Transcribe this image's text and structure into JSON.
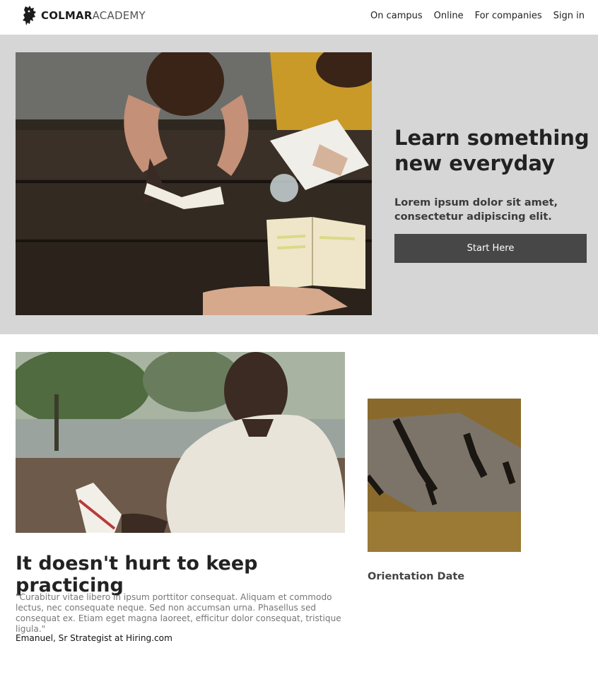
{
  "header": {
    "logo": {
      "bold": "COLMAR",
      "light": "ACADEMY"
    },
    "nav": [
      "On campus",
      "Online",
      "For companies",
      "Sign in"
    ]
  },
  "hero": {
    "title": "Learn something new everyday",
    "subtitle": "Lorem ipsum dolor sit amet, consectetur adipiscing elit.",
    "button_label": "Start Here"
  },
  "practice": {
    "title": "It doesn't hurt to keep practicing",
    "quote": "\"Curabitur vitae libero in ipsum porttitor consequat. Aliquam et commodo lectus, nec consequate neque. Sed non accumsan urna. Phasellus sed consequat ex. Etiam eget magna laoreet, efficitur dolor consequat, tristique ligula.\"",
    "author": "Emanuel, Sr Strategist at Hiring.com"
  },
  "orientation": {
    "label": "Orientation Date"
  },
  "colors": {
    "hero_bg": "#d6d6d6",
    "button_bg": "#474747",
    "text_dark": "#222222",
    "quote_text": "#777777"
  }
}
